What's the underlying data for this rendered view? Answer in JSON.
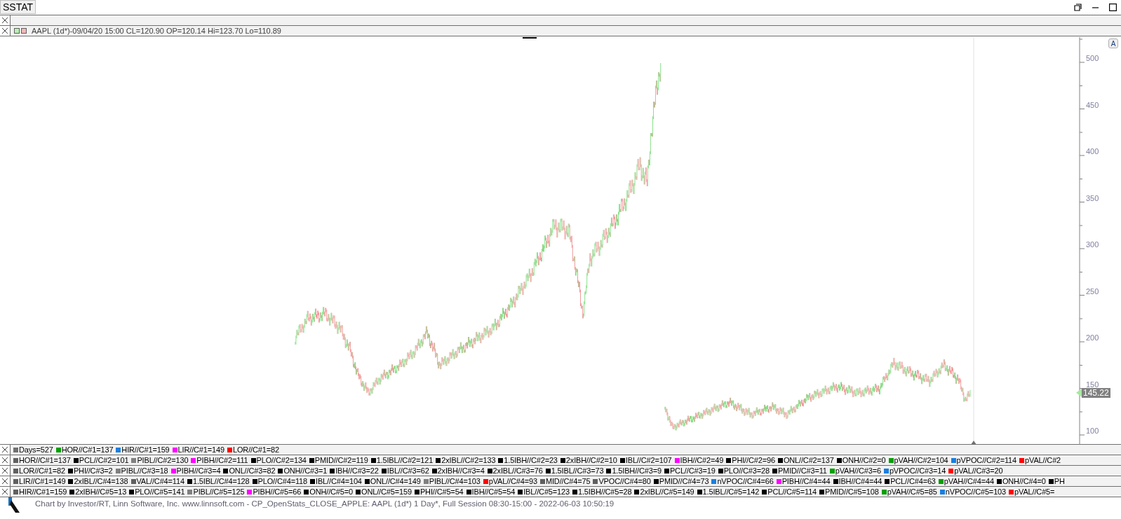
{
  "window": {
    "tab": "SSTAT"
  },
  "legend": {
    "text": "AAPL (1d*)-09/04/20 15:00 CL=120.90 OP=120.14 Hi=123.70 Lo=110.89"
  },
  "chart": {
    "autoscale_button": "A",
    "last_price": "145.22",
    "y_axis_labels": [
      "500",
      "450",
      "400",
      "350",
      "300",
      "250",
      "200",
      "150",
      "100"
    ]
  },
  "stat_rows": [
    {
      "items": [
        {
          "text": "Days=527",
          "color": "#707070"
        },
        {
          "text": "HOR//C#1=137",
          "color": "#00a000"
        },
        {
          "text": "HIR//C#1=159",
          "color": "#1a7fe0"
        },
        {
          "text": "LIR//C#1=149",
          "color": "#ff00ff"
        },
        {
          "text": "LOR//C#1=82",
          "color": "#ff0000"
        }
      ]
    },
    {
      "items": [
        {
          "text": "HOR//C#1=137",
          "color": "#606060"
        },
        {
          "text": "PCL//C#2=101",
          "color": "#000000"
        },
        {
          "text": "PIBL//C#2=130",
          "color": "#808080"
        },
        {
          "text": "PIBH//C#2=111",
          "color": "#ff00ff"
        },
        {
          "text": "PLO//C#2=134",
          "color": "#000000"
        },
        {
          "text": "PMID//C#2=119",
          "color": "#000000"
        },
        {
          "text": "1.5IBL//C#2=121",
          "color": "#000000"
        },
        {
          "text": "2xIBL//C#2=133",
          "color": "#000000"
        },
        {
          "text": "1.5IBH//C#2=23",
          "color": "#000000"
        },
        {
          "text": "2xIBH//C#2=10",
          "color": "#000000"
        },
        {
          "text": "IBL//C#2=107",
          "color": "#000000"
        },
        {
          "text": "IBH//C#2=49",
          "color": "#ff00ff"
        },
        {
          "text": "PHI//C#2=96",
          "color": "#000000"
        },
        {
          "text": "ONL//C#2=137",
          "color": "#000000"
        },
        {
          "text": "ONH//C#2=0",
          "color": "#000000"
        },
        {
          "text": "pVAH//C#2=104",
          "color": "#00a000"
        },
        {
          "text": "pVPOC//C#2=114",
          "color": "#1a7fe0"
        },
        {
          "text": "pVAL//C#2",
          "color": "#ff0000"
        }
      ]
    },
    {
      "items": [
        {
          "text": "LOR//C#1=82",
          "color": "#606060"
        },
        {
          "text": "PHI//C#3=2",
          "color": "#000000"
        },
        {
          "text": "PIBL//C#3=18",
          "color": "#808080"
        },
        {
          "text": "PIBH//C#3=4",
          "color": "#ff00ff"
        },
        {
          "text": "ONL//C#3=82",
          "color": "#000000"
        },
        {
          "text": "ONH//C#3=1",
          "color": "#000000"
        },
        {
          "text": "IBH//C#3=22",
          "color": "#000000"
        },
        {
          "text": "IBL//C#3=62",
          "color": "#000000"
        },
        {
          "text": "2xIBH//C#3=4",
          "color": "#000000"
        },
        {
          "text": "2xIBL//C#3=76",
          "color": "#000000"
        },
        {
          "text": "1.5IBL//C#3=73",
          "color": "#000000"
        },
        {
          "text": "1.5IBH//C#3=9",
          "color": "#000000"
        },
        {
          "text": "PCL//C#3=19",
          "color": "#000000"
        },
        {
          "text": "PLO//C#3=28",
          "color": "#000000"
        },
        {
          "text": "PMID//C#3=11",
          "color": "#000000"
        },
        {
          "text": "pVAH//C#3=6",
          "color": "#00a000"
        },
        {
          "text": "pVPOC//C#3=14",
          "color": "#1a7fe0"
        },
        {
          "text": "pVAL//C#3=20",
          "color": "#ff0000"
        }
      ]
    },
    {
      "items": [
        {
          "text": "LIR//C#1=149",
          "color": "#606060"
        },
        {
          "text": "2xIBL//C#4=138",
          "color": "#000000"
        },
        {
          "text": "VAL//C#4=114",
          "color": "#606060"
        },
        {
          "text": "1.5IBL//C#4=128",
          "color": "#000000"
        },
        {
          "text": "PLO//C#4=118",
          "color": "#000000"
        },
        {
          "text": "IBL//C#4=104",
          "color": "#000000"
        },
        {
          "text": "ONL//C#4=149",
          "color": "#000000"
        },
        {
          "text": "PIBL//C#4=103",
          "color": "#808080"
        },
        {
          "text": "pVAL//C#4=93",
          "color": "#ff0000"
        },
        {
          "text": "MID//C#4=75",
          "color": "#606060"
        },
        {
          "text": "VPOC//C#4=80",
          "color": "#606060"
        },
        {
          "text": "PMID//C#4=73",
          "color": "#000000"
        },
        {
          "text": "nVPOC//C#4=66",
          "color": "#1a7fe0"
        },
        {
          "text": "PIBH//C#4=44",
          "color": "#ff00ff"
        },
        {
          "text": "IBH//C#4=44",
          "color": "#000000"
        },
        {
          "text": "PCL//C#4=63",
          "color": "#000000"
        },
        {
          "text": "pVAH//C#4=44",
          "color": "#00a000"
        },
        {
          "text": "ONH//C#4=0",
          "color": "#000000"
        },
        {
          "text": "PH",
          "color": "#000000"
        }
      ]
    },
    {
      "items": [
        {
          "text": "HIR//C#1=159",
          "color": "#606060"
        },
        {
          "text": "2xIBH//C#5=13",
          "color": "#000000"
        },
        {
          "text": "PLO//C#5=141",
          "color": "#000000"
        },
        {
          "text": "PIBL//C#5=125",
          "color": "#808080"
        },
        {
          "text": "PIBH//C#5=66",
          "color": "#ff00ff"
        },
        {
          "text": "ONH//C#5=0",
          "color": "#000000"
        },
        {
          "text": "ONL//C#5=159",
          "color": "#000000"
        },
        {
          "text": "PHI//C#5=54",
          "color": "#000000"
        },
        {
          "text": "IBH//C#5=54",
          "color": "#000000"
        },
        {
          "text": "IBL//C#5=123",
          "color": "#000000"
        },
        {
          "text": "1.5IBH//C#5=28",
          "color": "#000000"
        },
        {
          "text": "2xIBL//C#5=149",
          "color": "#000000"
        },
        {
          "text": "1.5IBL//C#5=142",
          "color": "#000000"
        },
        {
          "text": "PCL//C#5=114",
          "color": "#000000"
        },
        {
          "text": "PMID//C#5=108",
          "color": "#000000"
        },
        {
          "text": "pVAH//C#5=85",
          "color": "#00a000"
        },
        {
          "text": "nVPOC//C#5=103",
          "color": "#1a7fe0"
        },
        {
          "text": "pVAL//C#5=",
          "color": "#ff0000"
        }
      ]
    }
  ],
  "footer": {
    "text": "Chart by Investor/RT, Linn Software, Inc. www.linnsoft.com - CP_OpenStats_CLOSE_APPLE: AAPL (1d*) 1 Day*, Full Session 08:30-15:00 - 2022-06-03 10:50:19"
  }
}
